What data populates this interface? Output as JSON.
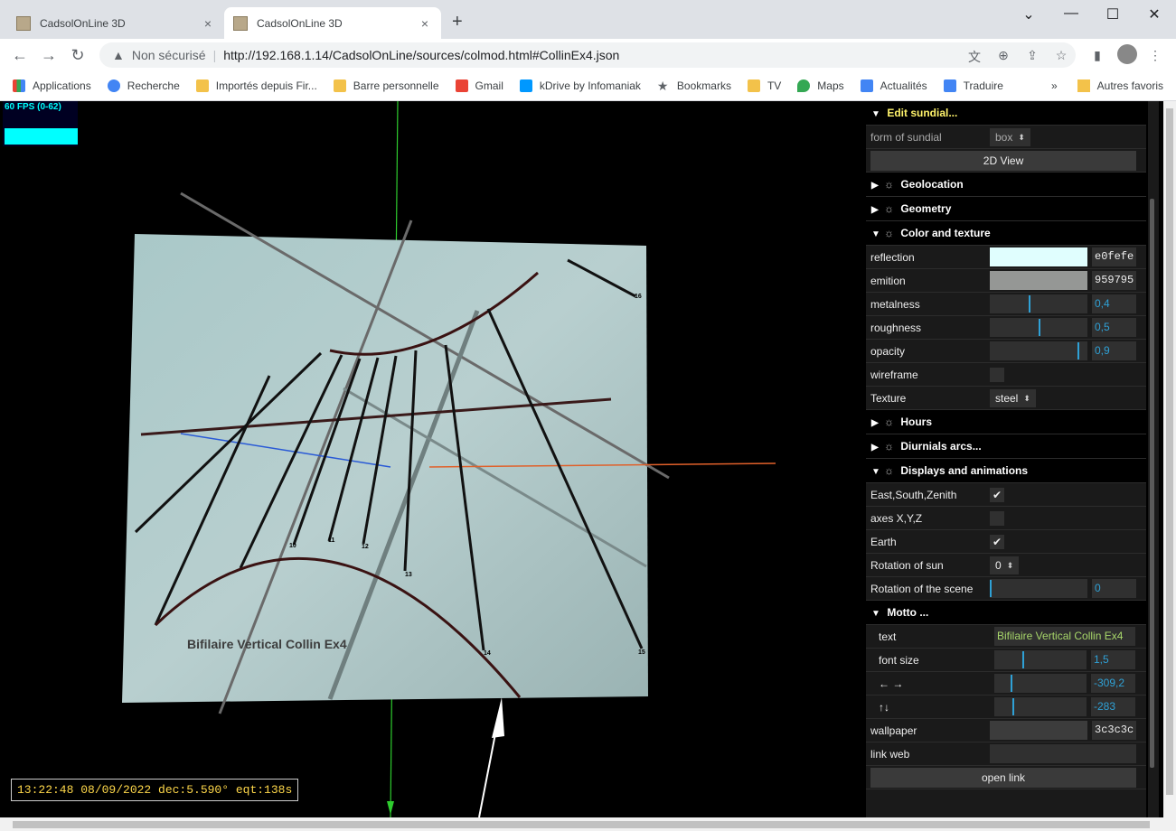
{
  "browser": {
    "tabs": [
      {
        "title": "CadsolOnLine 3D",
        "close": "×"
      },
      {
        "title": "CadsolOnLine 3D",
        "close": "×"
      }
    ],
    "new_tab": "+",
    "window_controls": {
      "minimize": "⌄",
      "min": "—",
      "max": "☐",
      "close": "✕"
    },
    "security_label": "Non sécurisé",
    "url": "http://192.168.1.14/CadsolOnLine/sources/colmod.html#CollinEx4.json",
    "bookmarks": [
      {
        "label": "Applications",
        "icon": "apps-grid-icon"
      },
      {
        "label": "Recherche",
        "icon": "google-icon"
      },
      {
        "label": "Importés depuis Fir...",
        "icon": "folder-icon"
      },
      {
        "label": "Barre personnelle",
        "icon": "folder-icon"
      },
      {
        "label": "Gmail",
        "icon": "gmail-icon"
      },
      {
        "label": "kDrive by Infomaniak",
        "icon": "kdrive-icon"
      },
      {
        "label": "Bookmarks",
        "icon": "star-icon"
      },
      {
        "label": "TV",
        "icon": "folder-icon"
      },
      {
        "label": "Maps",
        "icon": "maps-icon"
      },
      {
        "label": "Actualités",
        "icon": "news-icon"
      },
      {
        "label": "Traduire",
        "icon": "translate-icon"
      }
    ],
    "more_bookmarks": "»",
    "other_bookmarks": "Autres favoris"
  },
  "viewport": {
    "fps": "60 FPS (0-62)",
    "dial_text": "Bifilaire Vertical Collin Ex4",
    "hour_labels": [
      "10",
      "11",
      "12",
      "13",
      "14",
      "15",
      "16"
    ],
    "status": "13:22:48 08/09/2022 dec:5.590° eqt:138s"
  },
  "gui": {
    "edit_title": "Edit sundial...",
    "form_label": "form of sundial",
    "form_value": "box",
    "view2d": "2D View",
    "folders": {
      "geolocation": "Geolocation",
      "geometry": "Geometry",
      "color": "Color and texture",
      "hours": "Hours",
      "diurnal": "Diurnials arcs...",
      "displays": "Displays and animations",
      "motto": "Motto ..."
    },
    "color": {
      "reflection_label": "reflection",
      "reflection_hex": "e0fefe",
      "reflection_color": "#e0fefe",
      "emition_label": "emition",
      "emition_hex": "959795",
      "emition_color": "#959795",
      "metalness_label": "metalness",
      "metalness_value": "0,4",
      "metalness_level": 0.4,
      "roughness_label": "roughness",
      "roughness_value": "0,5",
      "roughness_level": 0.5,
      "opacity_label": "opacity",
      "opacity_value": "0,9",
      "opacity_level": 0.9,
      "wireframe_label": "wireframe",
      "texture_label": "Texture",
      "texture_value": "steel"
    },
    "displays": {
      "esz_label": "East,South,Zenith",
      "esz_checked": "✔",
      "axes_label": "axes X,Y,Z",
      "earth_label": "Earth",
      "earth_checked": "✔",
      "rotsun_label": "Rotation of sun",
      "rotsun_value": "0",
      "rotscene_label": "Rotation of the scene",
      "rotscene_value": "0",
      "rotscene_level": 0
    },
    "motto": {
      "text_label": "text",
      "text_value": "Bifilaire Vertical Collin Ex4",
      "fontsize_label": "font size",
      "fontsize_value": "1,5",
      "fontsize_level": 0.3,
      "lr_label": "← →",
      "lr_value": "-309,2",
      "lr_level": 0.18,
      "ud_label": "↑↓",
      "ud_value": "-283",
      "ud_level": 0.2
    },
    "wallpaper_label": "wallpaper",
    "wallpaper_hex": "3c3c3c",
    "wallpaper_color": "#3c3c3c",
    "link_label": "link web",
    "open_link": "open link"
  },
  "colors": {
    "gui_bg": "#1a1a1a",
    "slider_accent": "#2fa1d6",
    "text_green": "#a7d66a",
    "title_yellow": "#fff36b",
    "fps_cyan": "#00ffff"
  }
}
